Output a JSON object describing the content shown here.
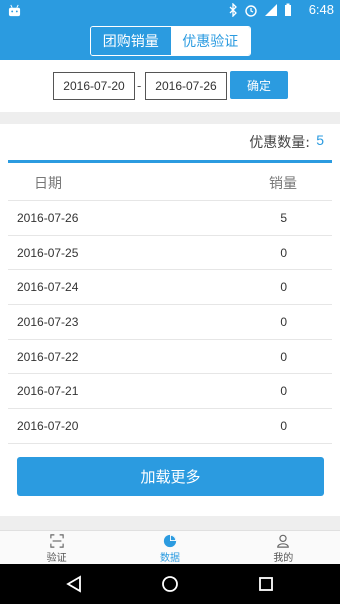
{
  "status_bar": {
    "time": "6:48"
  },
  "header": {
    "tabs": [
      {
        "label": "团购销量",
        "active": true
      },
      {
        "label": "优惠验证",
        "active": false
      }
    ]
  },
  "filter": {
    "start_date": "2016-07-20",
    "separator": "-",
    "end_date": "2016-07-26",
    "confirm_label": "确定"
  },
  "summary": {
    "label": "优惠数量:",
    "count": "5"
  },
  "table": {
    "headers": [
      "日期",
      "销量"
    ],
    "rows": [
      {
        "date": "2016-07-26",
        "value": "5"
      },
      {
        "date": "2016-07-25",
        "value": "0"
      },
      {
        "date": "2016-07-24",
        "value": "0"
      },
      {
        "date": "2016-07-23",
        "value": "0"
      },
      {
        "date": "2016-07-22",
        "value": "0"
      },
      {
        "date": "2016-07-21",
        "value": "0"
      },
      {
        "date": "2016-07-20",
        "value": "0"
      }
    ]
  },
  "load_more_label": "加载更多",
  "bottom_tabs": [
    {
      "label": "验证",
      "icon": "scan-icon",
      "active": false
    },
    {
      "label": "数据",
      "icon": "pie-chart-icon",
      "active": true
    },
    {
      "label": "我的",
      "icon": "person-icon",
      "active": false
    }
  ],
  "colors": {
    "accent": "#2b9be0",
    "divider": "#eeeeee"
  }
}
